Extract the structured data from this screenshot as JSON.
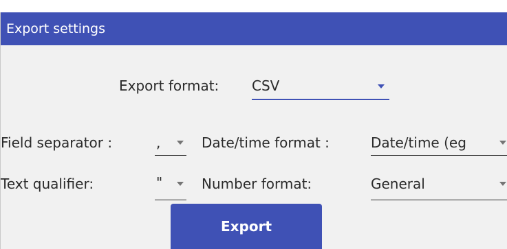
{
  "dialog": {
    "title": "Export settings"
  },
  "export_format": {
    "label": "Export format:",
    "value": "CSV"
  },
  "field_separator": {
    "label": "Field separator :",
    "value": ","
  },
  "datetime_format": {
    "label": "Date/time format :",
    "value": "Date/time (eg"
  },
  "text_qualifier": {
    "label": "Text qualifier:",
    "value": "\""
  },
  "number_format": {
    "label": "Number format:",
    "value": "General"
  },
  "actions": {
    "export_label": "Export"
  },
  "colors": {
    "accent": "#3f51b5",
    "panel_bg": "#f1f1f1",
    "text": "#2a2a2a"
  },
  "icons": [
    "chevron-down-icon"
  ]
}
